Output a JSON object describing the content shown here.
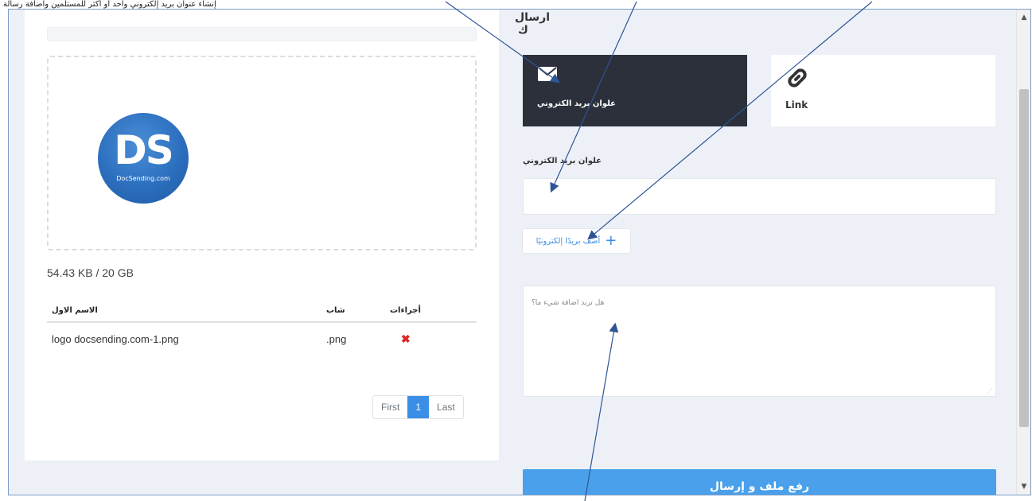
{
  "caption": "إنشاء عنوان بريد إلكتروني واحد أو أكثر للمستلمين واضافة رسالة",
  "left": {
    "usage_text": "54.43 KB / 20 GB",
    "logo": {
      "monogram": "DS",
      "text": "DocSending.com"
    },
    "table": {
      "headers": {
        "name": "الاسم الاول",
        "type": "شاب",
        "actions": "أجراءات"
      },
      "rows": [
        {
          "name": "logo docsending.com-1.png",
          "type": ".png",
          "action_icon": "delete-icon"
        }
      ]
    },
    "pager": {
      "first": "First",
      "current": "1",
      "last": "Last"
    }
  },
  "right": {
    "title": "ارسال ك",
    "modes": {
      "email": {
        "icon": "envelope-icon",
        "label": "علوان بريد الكتروني"
      },
      "link": {
        "icon": "link-icon",
        "label": "Link"
      }
    },
    "email_field_label": "علوان بريد الكتروني",
    "email_input": {
      "value": "",
      "placeholder": ""
    },
    "add_email_label": "أضف بريدًا إلكترونيًا",
    "message_placeholder": "هل تريد اضافة شيء ما؟",
    "submit_label": "رفع ملف و إرسال"
  },
  "colors": {
    "accent": "#3b8ee6",
    "dark_card": "#2b303b",
    "submit": "#4aa0ea",
    "delete": "#e02424",
    "annotation": "#2f5597"
  }
}
